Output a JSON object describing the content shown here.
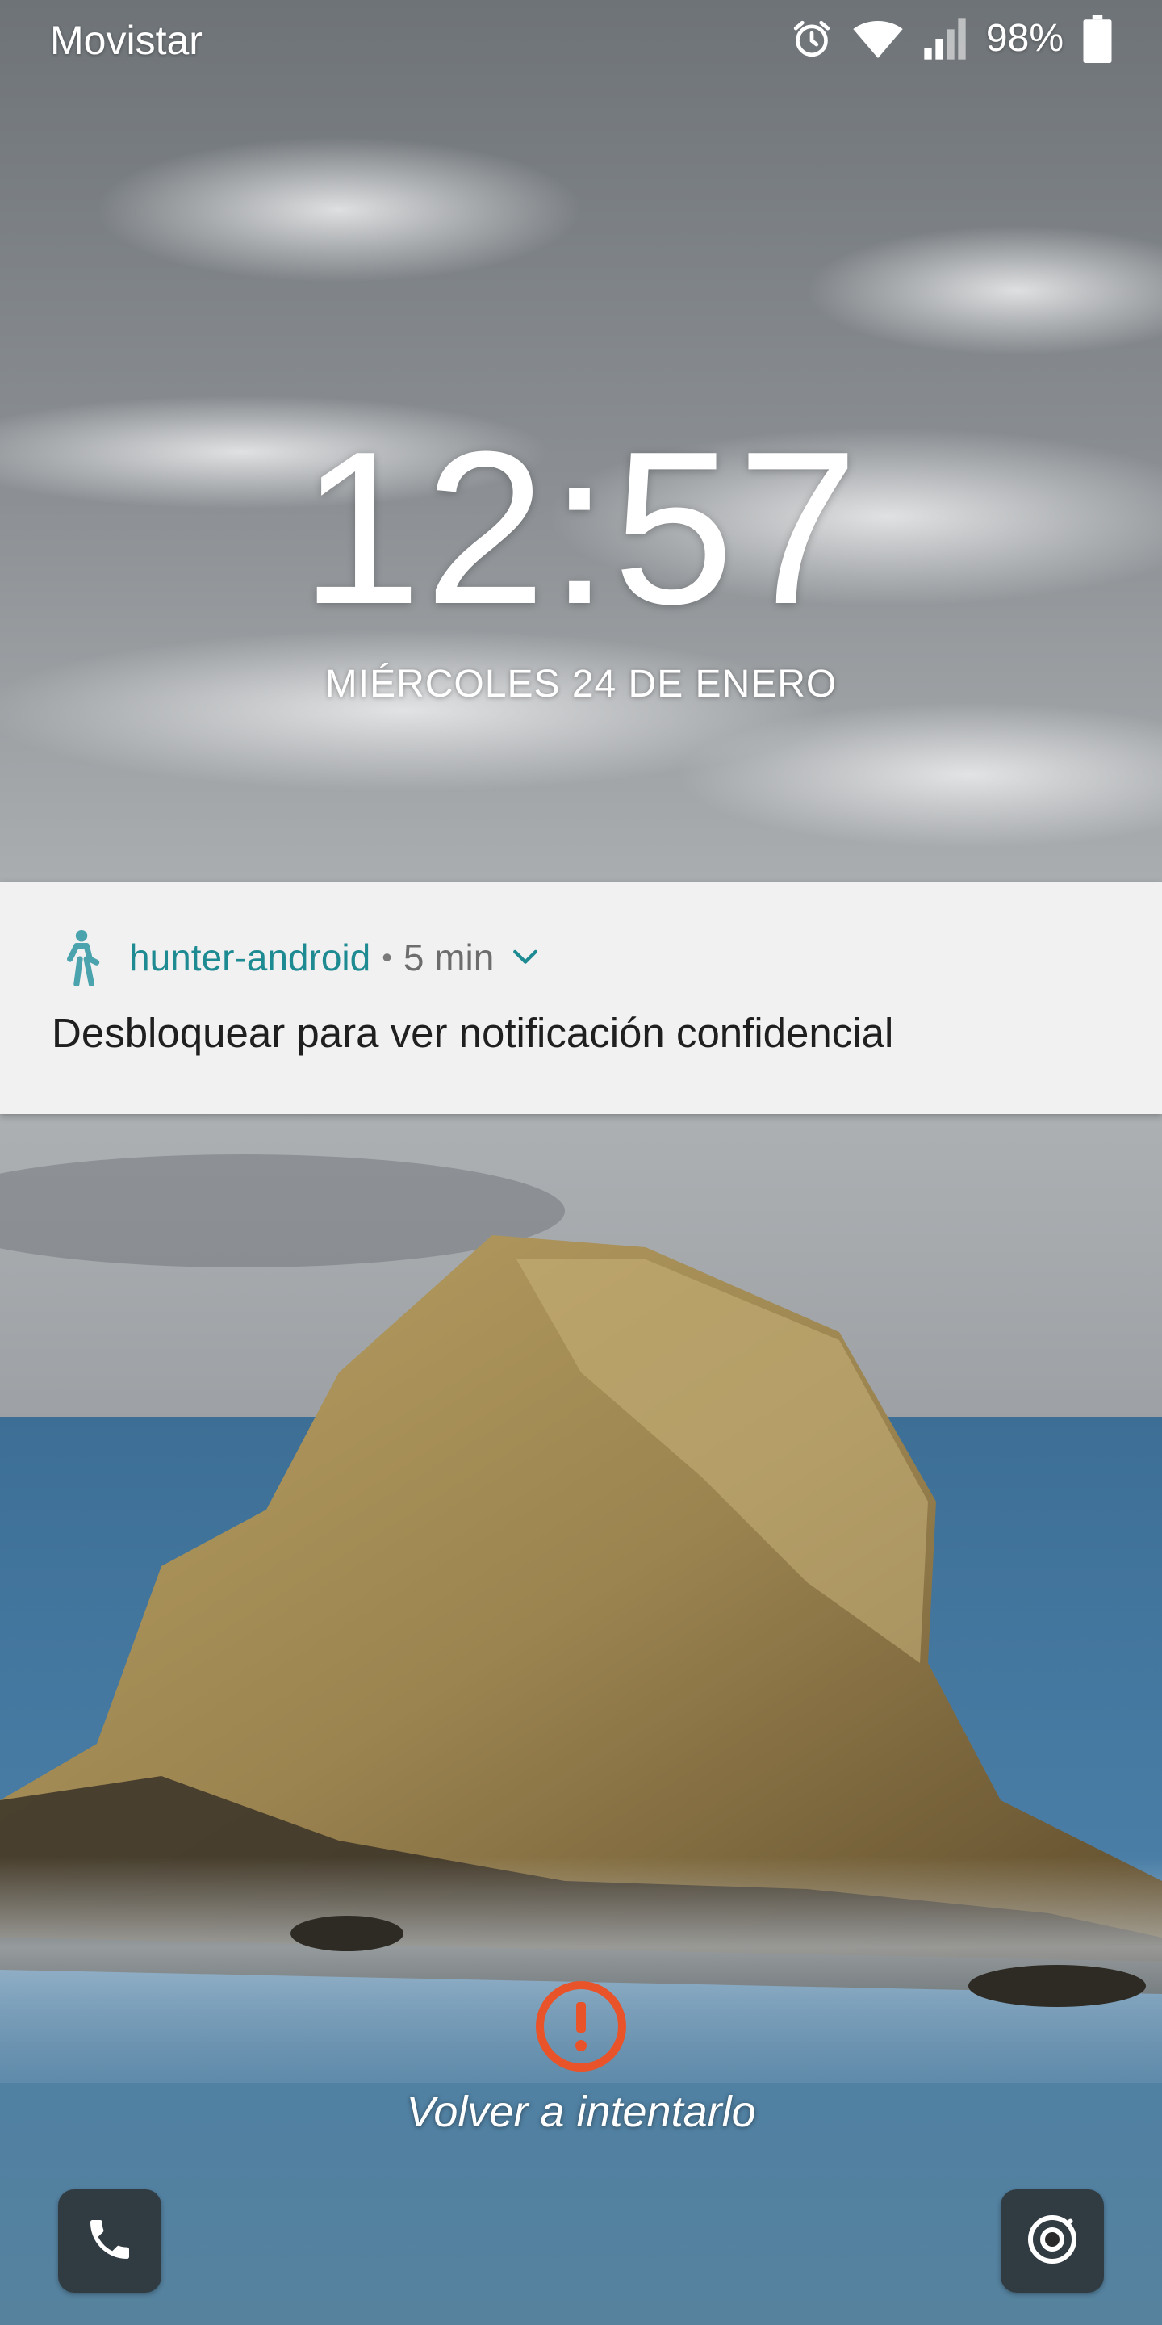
{
  "status_bar": {
    "carrier": "Movistar",
    "battery_percent": "98%",
    "icons": [
      "alarm-icon",
      "wifi-icon",
      "signal-icon",
      "battery-icon"
    ]
  },
  "lock_screen": {
    "time": "12:57",
    "date": "MIÉRCOLES 24 DE ENERO"
  },
  "notification": {
    "app_icon": "walking-person-icon",
    "app_name": "hunter-android",
    "separator": "•",
    "time_ago": "5 min",
    "body": "Desbloquear para ver notificación confidencial",
    "accent_color": "#1e8a92"
  },
  "retry": {
    "icon": "alert-circle-icon",
    "label": "Volver a intentarlo",
    "color": "#e8532a"
  },
  "bottom_actions": {
    "left": "phone-icon",
    "right": "camera-icon"
  }
}
